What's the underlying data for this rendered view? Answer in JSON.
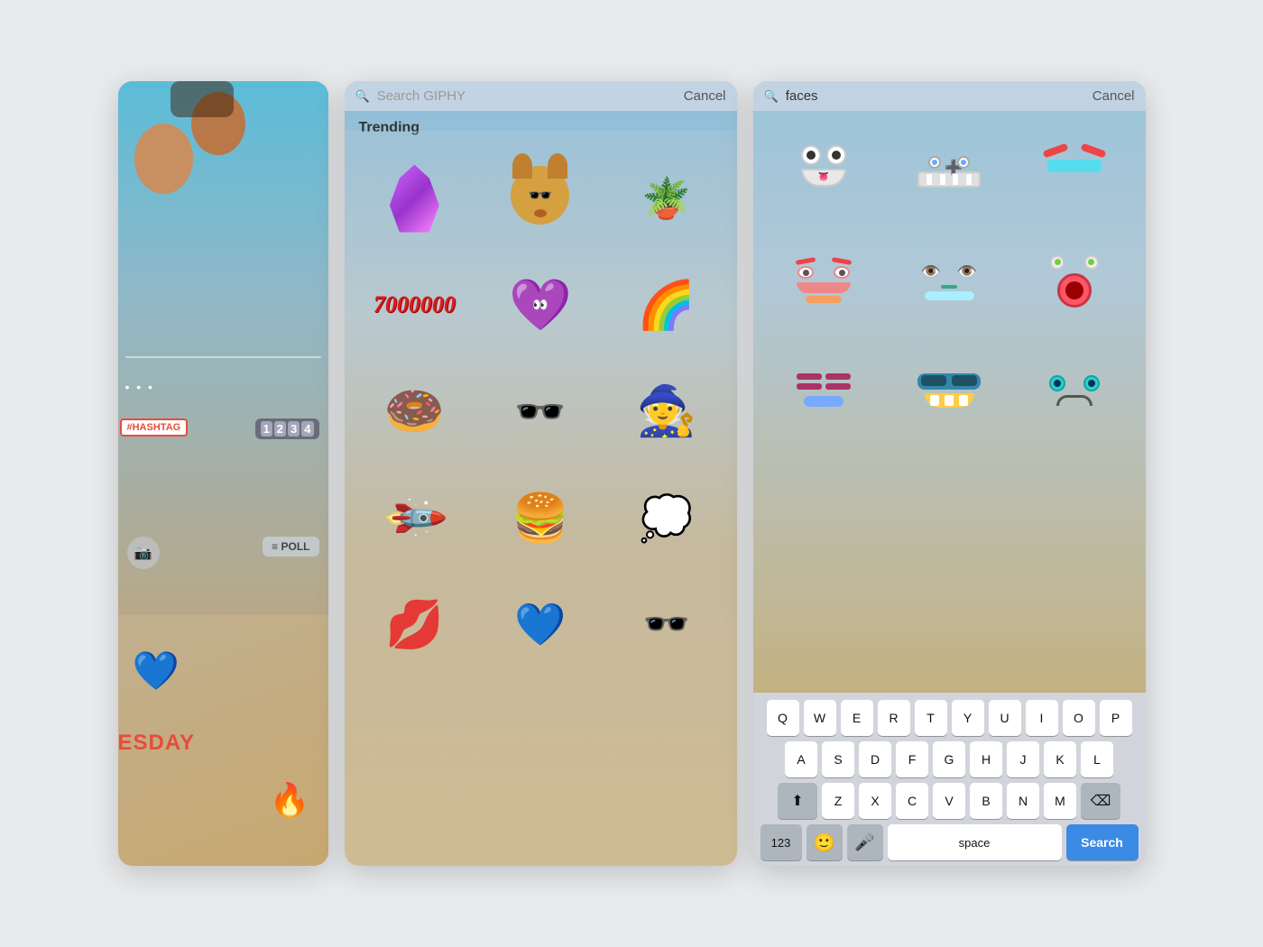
{
  "left_panel": {
    "stickers": [
      "#HASHTAG",
      "1",
      "2",
      "3",
      "4"
    ],
    "poll_label": "≡ POLL",
    "tuesday_label": "ESDAY",
    "three_dots": "• • •"
  },
  "middle_panel": {
    "search_placeholder": "Search GIPHY",
    "cancel_label": "Cancel",
    "trending_label": "Trending",
    "stickers": [
      "crystal",
      "dog",
      "plant",
      "7000000",
      "purple_heart",
      "rainbow",
      "donut",
      "sunglasses",
      "wizard_hat",
      "rocket",
      "burger",
      "thought_cloud",
      "lips",
      "pixel_heart",
      "rainbow_glasses"
    ]
  },
  "right_panel": {
    "search_value": "faces",
    "cancel_label": "Cancel",
    "face_stickers": [
      "monster_face_1",
      "monster_face_2",
      "monster_face_3",
      "face_orange",
      "face_green",
      "face_pink",
      "face_purple",
      "face_blue_glasses",
      "face_teal",
      "placeholder",
      "placeholder",
      "placeholder"
    ],
    "keyboard": {
      "row1": [
        "Q",
        "W",
        "E",
        "R",
        "T",
        "Y",
        "U",
        "I",
        "O",
        "P"
      ],
      "row2": [
        "A",
        "S",
        "D",
        "F",
        "G",
        "H",
        "J",
        "K",
        "L"
      ],
      "row3": [
        "Z",
        "X",
        "C",
        "V",
        "B",
        "N",
        "M"
      ],
      "bottom": {
        "num_label": "123",
        "space_label": "space",
        "search_label": "Search"
      }
    }
  }
}
